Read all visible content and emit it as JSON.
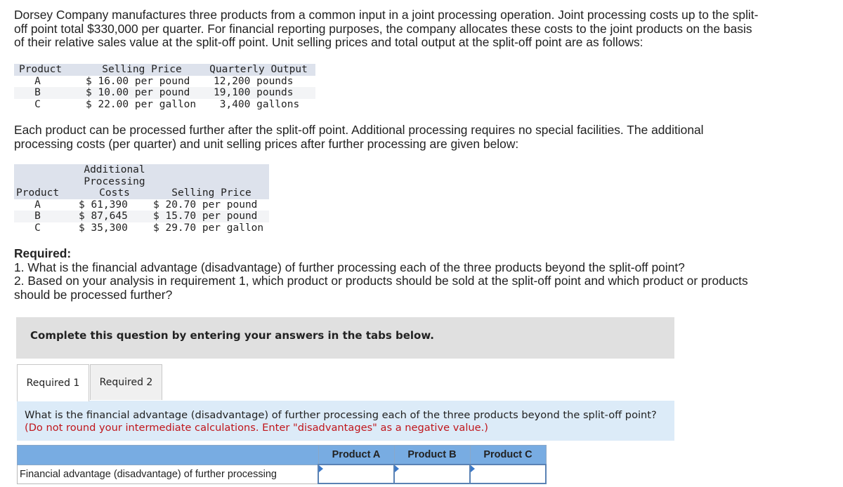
{
  "intro": {
    "paragraph": "Dorsey Company manufactures three products from a common input in a joint processing operation. Joint processing costs up to the split-off point total $330,000 per quarter. For financial reporting purposes, the company allocates these costs to the joint products on the basis of their relative sales value at the split-off point. Unit selling prices and total output at the split-off point are as follows:"
  },
  "split_off_table": {
    "headers": [
      "Product",
      "Selling Price",
      "Quarterly Output"
    ],
    "rows": [
      {
        "product": "A",
        "price": "$ 16.00 per pound",
        "output": "12,200 pounds"
      },
      {
        "product": "B",
        "price": "$ 10.00 per pound",
        "output": "19,100 pounds"
      },
      {
        "product": "C",
        "price": "$ 22.00 per gallon",
        "output": " 3,400 gallons"
      }
    ]
  },
  "further_text": "Each product can be processed further after the split-off point. Additional processing requires no special facilities. The additional processing costs (per quarter) and unit selling prices after further processing are given below:",
  "further_table": {
    "headers": {
      "product": "Product",
      "costs_line1": "Additional",
      "costs_line2": "Processing",
      "costs_line3": "Costs",
      "price": "Selling Price"
    },
    "rows": [
      {
        "product": "A",
        "cost": "$ 61,390",
        "price": "$ 20.70 per pound"
      },
      {
        "product": "B",
        "cost": "$ 87,645",
        "price": "$ 15.70 per pound"
      },
      {
        "product": "C",
        "cost": "$ 35,300",
        "price": "$ 29.70 per gallon"
      }
    ]
  },
  "required": {
    "heading": "Required:",
    "items": [
      "1. What is the financial advantage (disadvantage) of further processing each of the three products beyond the split-off point?",
      "2. Based on your analysis in requirement 1, which product or products should be sold at the split-off point and which product or products should be processed further?"
    ]
  },
  "instruction_panel": "Complete this question by entering your answers in the tabs below.",
  "tabs": [
    {
      "label": "Required 1",
      "active": true
    },
    {
      "label": "Required 2",
      "active": false
    }
  ],
  "question": {
    "text": "What is the financial advantage (disadvantage) of further processing each of the three products beyond the split-off point?",
    "note": "(Do not round your intermediate calculations. Enter \"disadvantages\" as a negative value.)"
  },
  "answer_table": {
    "columns": [
      "",
      "Product A",
      "Product B",
      "Product C"
    ],
    "row_label": "Financial advantage (disadvantage) of further processing",
    "values": [
      "",
      "",
      ""
    ]
  }
}
